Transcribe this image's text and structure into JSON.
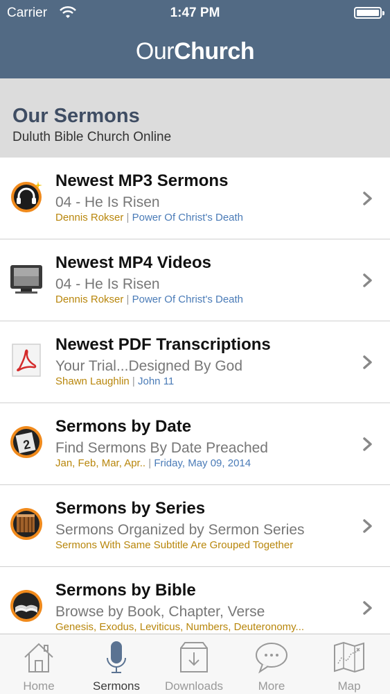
{
  "status_bar": {
    "carrier": "Carrier",
    "time": "1:47 PM"
  },
  "app": {
    "title_light": "Our",
    "title_bold": "Church"
  },
  "header": {
    "title": "Our Sermons",
    "subtitle": "Duluth Bible Church Online"
  },
  "rows": [
    {
      "icon": "headphones-icon",
      "title": "Newest MP3 Sermons",
      "subtitle": "04 - He Is Risen",
      "meta_a": "Dennis Rokser",
      "meta_sep": " | ",
      "meta_b": "Power Of Christ's Death"
    },
    {
      "icon": "monitor-icon",
      "title": "Newest MP4 Videos",
      "subtitle": "04 - He Is Risen",
      "meta_a": "Dennis Rokser",
      "meta_sep": " | ",
      "meta_b": "Power Of Christ's Death"
    },
    {
      "icon": "pdf-icon",
      "title": "Newest PDF Transcriptions",
      "subtitle": "Your Trial...Designed By God",
      "meta_a": "Shawn Laughlin",
      "meta_sep": " | ",
      "meta_b": "John 11"
    },
    {
      "icon": "calendar-icon",
      "title": "Sermons by Date",
      "subtitle": "Find Sermons By Date Preached",
      "meta_a": "Jan, Feb, Mar, Apr..",
      "meta_sep": " | ",
      "meta_b": "Friday, May 09, 2014"
    },
    {
      "icon": "books-icon",
      "title": "Sermons by Series",
      "subtitle": "Sermons Organized by Sermon Series",
      "meta_a": "Sermons With Same Subtitle Are Grouped Together",
      "meta_sep": "",
      "meta_b": ""
    },
    {
      "icon": "bible-icon",
      "title": "Sermons by Bible",
      "subtitle": "Browse by Book, Chapter, Verse",
      "meta_a": "Genesis, Exodus, Leviticus, Numbers, Deuteronomy...",
      "meta_sep": "",
      "meta_b": ""
    }
  ],
  "tabs": [
    {
      "label": "Home",
      "icon": "home-icon"
    },
    {
      "label": "Sermons",
      "icon": "microphone-icon",
      "active": true
    },
    {
      "label": "Downloads",
      "icon": "download-icon"
    },
    {
      "label": "More",
      "icon": "chat-bubble-icon"
    },
    {
      "label": "Map",
      "icon": "map-icon"
    }
  ],
  "colors": {
    "nav_bar": "#526a84",
    "header_bg": "#dcdcdc",
    "meta_gold": "#b8860b",
    "meta_blue": "#4a7bb7"
  }
}
